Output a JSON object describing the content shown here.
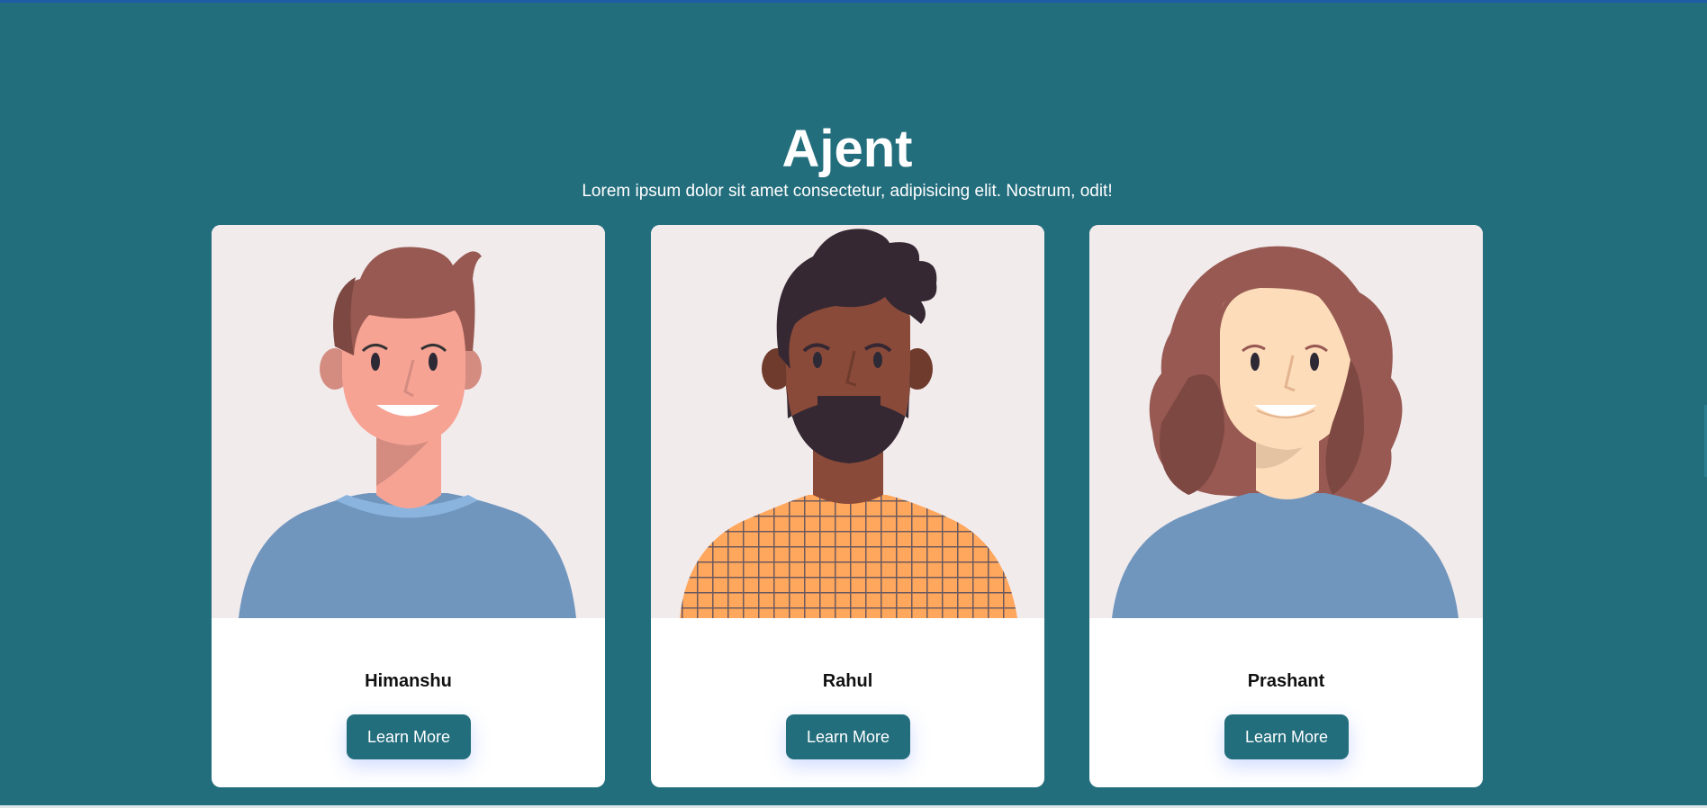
{
  "header": {
    "title": "Ajent",
    "subtitle": "Lorem ipsum dolor sit amet consectetur, adipisicing elit. Nostrum, odit!"
  },
  "cards": [
    {
      "name": "Himanshu",
      "button_label": "Learn More",
      "avatar": "man-avatar-brown-hair-icon"
    },
    {
      "name": "Rahul",
      "button_label": "Learn More",
      "avatar": "man-avatar-beard-icon"
    },
    {
      "name": "Prashant",
      "button_label": "Learn More",
      "avatar": "woman-avatar-long-hair-icon"
    }
  ],
  "colors": {
    "background": "#236e7d",
    "card": "#ffffff",
    "avatar_bg": "#f2ebec",
    "button": "#236e7d",
    "button_text": "#ffffff"
  }
}
